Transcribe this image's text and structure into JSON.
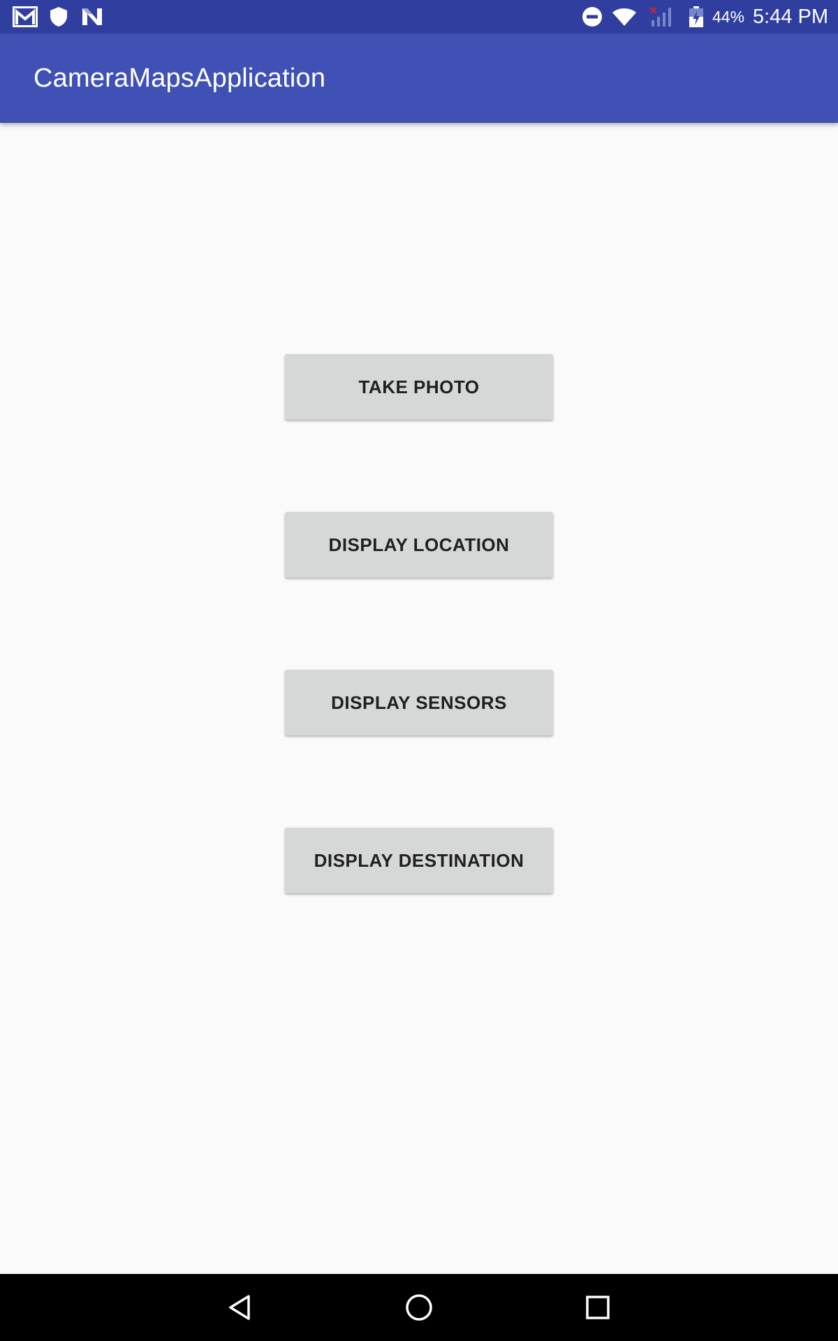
{
  "status_bar": {
    "battery_percent": "44%",
    "time": "5:44 PM",
    "left_icons": [
      "gmail-icon",
      "shield-icon",
      "n-app-icon"
    ],
    "right_icons": [
      "do-not-disturb-icon",
      "wifi-icon",
      "cellular-no-signal-icon",
      "battery-charging-icon"
    ]
  },
  "app_bar": {
    "title": "CameraMapsApplication",
    "color": "#3F51B5",
    "status_color": "#303F9F"
  },
  "buttons": {
    "take_photo": "TAKE PHOTO",
    "display_location": "DISPLAY LOCATION",
    "display_sensors": "DISPLAY SENSORS",
    "display_destination": "DISPLAY DESTINATION"
  },
  "nav_bar": {
    "items": [
      "back-icon",
      "home-icon",
      "recents-icon"
    ]
  }
}
